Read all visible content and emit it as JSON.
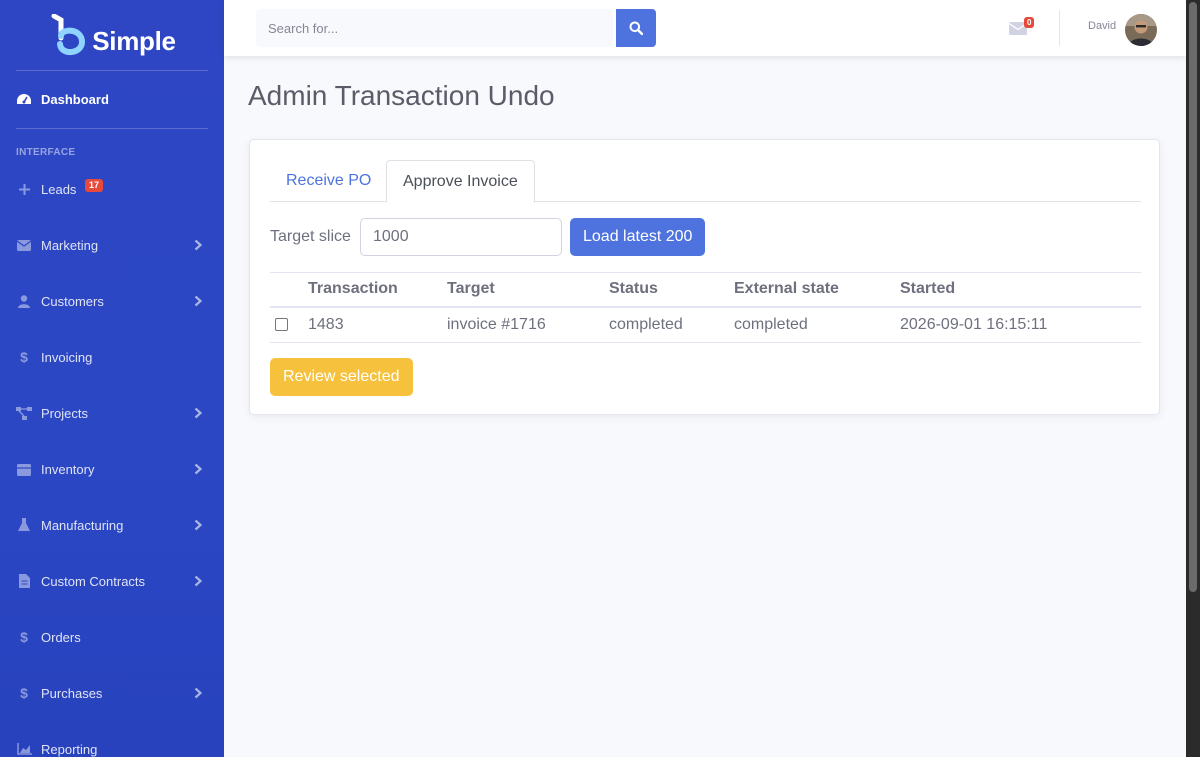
{
  "brand": {
    "name": "Simple"
  },
  "sidebar": {
    "dashboard": "Dashboard",
    "heading": "INTERFACE",
    "items": [
      {
        "label": "Leads",
        "icon": "plus-icon",
        "badge": "17",
        "chevron": false
      },
      {
        "label": "Marketing",
        "icon": "envelope-icon",
        "chevron": true
      },
      {
        "label": "Customers",
        "icon": "user-icon",
        "chevron": true
      },
      {
        "label": "Invoicing",
        "icon": "dollar-icon",
        "chevron": false
      },
      {
        "label": "Projects",
        "icon": "project-diagram-icon",
        "chevron": true
      },
      {
        "label": "Inventory",
        "icon": "boxes-icon",
        "chevron": true
      },
      {
        "label": "Manufacturing",
        "icon": "flask-icon",
        "chevron": true
      },
      {
        "label": "Custom Contracts",
        "icon": "file-icon",
        "chevron": true
      },
      {
        "label": "Orders",
        "icon": "dollar-icon",
        "chevron": false
      },
      {
        "label": "Purchases",
        "icon": "dollar-icon",
        "chevron": true
      },
      {
        "label": "Reporting",
        "icon": "chart-area-icon",
        "chevron": false
      }
    ]
  },
  "topbar": {
    "search_placeholder": "Search for...",
    "messages_count": "0",
    "user_name": "David"
  },
  "page": {
    "title": "Admin Transaction Undo",
    "tabs": [
      {
        "label": "Receive PO",
        "active": false
      },
      {
        "label": "Approve Invoice",
        "active": true
      }
    ],
    "slice_label": "Target slice",
    "slice_value": "1000",
    "load_button": "Load latest 200",
    "table": {
      "headers": [
        "Transaction",
        "Target",
        "Status",
        "External state",
        "Started"
      ],
      "rows": [
        {
          "transaction": "1483",
          "target": "invoice #1716",
          "status": "completed",
          "external_state": "completed",
          "started": "2026-09-01 16:15:11"
        }
      ]
    },
    "review_button": "Review selected"
  },
  "colors": {
    "sidebar": "#2e46c3",
    "primary": "#4e73df",
    "warning": "#f6c23e",
    "danger": "#e74a3b"
  }
}
